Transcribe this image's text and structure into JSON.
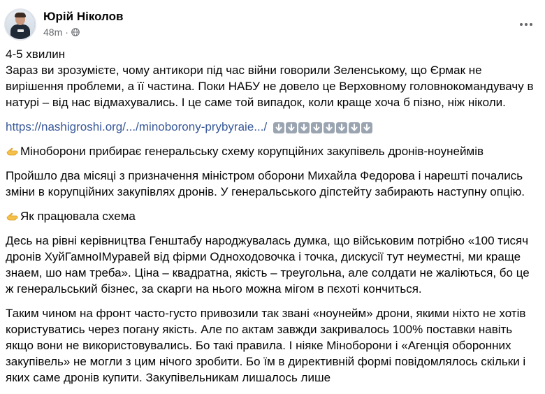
{
  "post": {
    "author": "Юрій Ніколов",
    "time": "48m",
    "privacy_icon": "globe-icon",
    "more_icon": "more-options-icon",
    "paragraphs": {
      "p1": "4-5 хвилин",
      "p2": "Зараз ви зрозумієте, чому антикори під час війни говорили Зеленському, що Єрмак не вирішення проблеми, а її частина. Поки НАБУ не довело це Верховному головнокомандувачу в натурі – від нас відмахувались. І це саме той випадок, коли краще хоча б пізно, ніж ніколи.",
      "link": "https://nashigroshi.org/.../minoborony-prybyraie.../",
      "h1": "Міноборони прибирає генеральську схему корупційних закупівель дронів-ноунеймів",
      "p3": "Пройшло два місяці з призначення міністром оборони Михайла Федорова і нарешті почались зміни в корупційних закупівлях дронів. У генеральського діпстейту забирають наступну опцію.",
      "h2": "Як працювала схема",
      "p4": "Десь на рівні керівництва Генштабу народжувалась думка, що військовим потрібно «100 тисяч дронів ХуйГамноІМуравей від фірми Одноходовочка і точка, дискусії тут неуместні, ми краще знаем, шо нам треба». Ціна – квадратна, якість – треугольна, але солдати не жаліються, бо це ж генеральський бізнес, за скарги на нього можна мігом в пєхоті кончиться.",
      "p5": "Таким чином на фронт часто-густо привозили так звані «ноунейм» дрони, якими ніхто не хотів користуватись через погану якість. Але по актам завжди закривалось 100% поставки навіть якщо вони не використовувались. Бо такі правила. І ніяке Міноборони і «Агенція оборонних закупівель» не могли з цим нічого зробити. Бо їм в директивній формі повідомлялось скільки і яких саме дронів купити. Закупівельникам лишалось лише"
    },
    "arrow_count": 8,
    "colors": {
      "link": "#385898",
      "secondary": "#65676b",
      "arrow_bg": "#9aa5b1"
    }
  }
}
